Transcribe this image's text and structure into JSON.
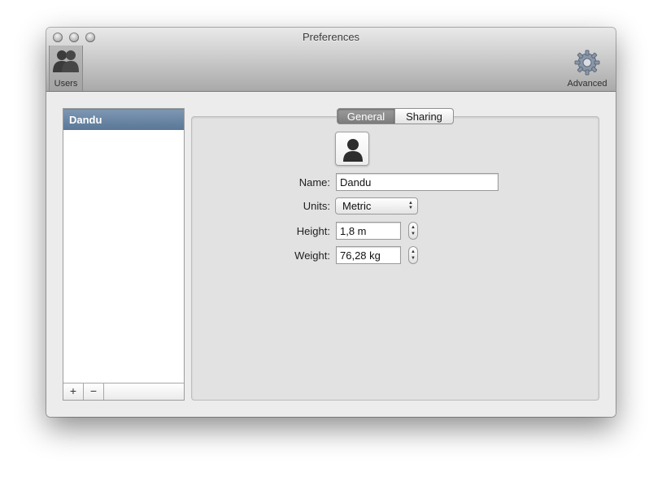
{
  "window": {
    "title": "Preferences"
  },
  "toolbar": {
    "users_label": "Users",
    "advanced_label": "Advanced"
  },
  "user_list": {
    "selected_user": "Dandu",
    "add_label": "+",
    "remove_label": "−"
  },
  "tabs": {
    "general": "General",
    "sharing": "Sharing",
    "active": "General"
  },
  "form": {
    "name_label": "Name:",
    "name_value": "Dandu",
    "units_label": "Units:",
    "units_value": "Metric",
    "height_label": "Height:",
    "height_value": "1,8 m",
    "weight_label": "Weight:",
    "weight_value": "76,28 kg"
  },
  "colors": {
    "selection": "#5a7797",
    "active_tab": "#7d7d7d"
  },
  "icons": {
    "users": "users-icon",
    "advanced": "gear-icon",
    "avatar": "person-silhouette-icon",
    "popup": "updown-arrows-icon",
    "stepper": "stepper-arrows-icon"
  }
}
